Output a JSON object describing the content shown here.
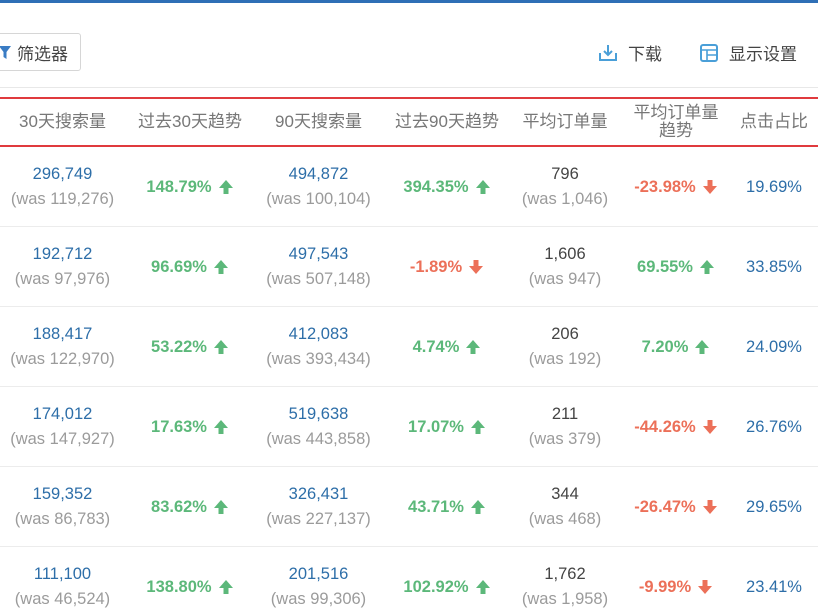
{
  "toolbar": {
    "filter_label": "筛选器",
    "download_label": "下载",
    "settings_label": "显示设置"
  },
  "columns": [
    {
      "label": "30天搜索量"
    },
    {
      "label": "过去30天趋势"
    },
    {
      "label": "90天搜索量"
    },
    {
      "label": "过去90天趋势"
    },
    {
      "label": "平均订单量"
    },
    {
      "label": "平均订单量趋势"
    },
    {
      "label": "点击占比"
    }
  ],
  "colors": {
    "up": "#5cb87a",
    "down": "#ec7059",
    "link_blue": "#2d6ea8",
    "highlight_border": "#e03a3e"
  },
  "rows": [
    {
      "search30": "296,749",
      "search30_was": "(was 119,276)",
      "trend30": "148.79%",
      "trend30_dir": "up",
      "search90": "494,872",
      "search90_was": "(was 100,104)",
      "trend90": "394.35%",
      "trend90_dir": "up",
      "orders": "796",
      "orders_was": "(was 1,046)",
      "orders_trend": "-23.98%",
      "orders_trend_dir": "down",
      "click_share": "19.69%"
    },
    {
      "search30": "192,712",
      "search30_was": "(was 97,976)",
      "trend30": "96.69%",
      "trend30_dir": "up",
      "search90": "497,543",
      "search90_was": "(was 507,148)",
      "trend90": "-1.89%",
      "trend90_dir": "down",
      "orders": "1,606",
      "orders_was": "(was 947)",
      "orders_trend": "69.55%",
      "orders_trend_dir": "up",
      "click_share": "33.85%"
    },
    {
      "search30": "188,417",
      "search30_was": "(was 122,970)",
      "trend30": "53.22%",
      "trend30_dir": "up",
      "search90": "412,083",
      "search90_was": "(was 393,434)",
      "trend90": "4.74%",
      "trend90_dir": "up",
      "orders": "206",
      "orders_was": "(was 192)",
      "orders_trend": "7.20%",
      "orders_trend_dir": "up",
      "click_share": "24.09%"
    },
    {
      "search30": "174,012",
      "search30_was": "(was 147,927)",
      "trend30": "17.63%",
      "trend30_dir": "up",
      "search90": "519,638",
      "search90_was": "(was 443,858)",
      "trend90": "17.07%",
      "trend90_dir": "up",
      "orders": "211",
      "orders_was": "(was 379)",
      "orders_trend": "-44.26%",
      "orders_trend_dir": "down",
      "click_share": "26.76%"
    },
    {
      "search30": "159,352",
      "search30_was": "(was 86,783)",
      "trend30": "83.62%",
      "trend30_dir": "up",
      "search90": "326,431",
      "search90_was": "(was 227,137)",
      "trend90": "43.71%",
      "trend90_dir": "up",
      "orders": "344",
      "orders_was": "(was 468)",
      "orders_trend": "-26.47%",
      "orders_trend_dir": "down",
      "click_share": "29.65%"
    },
    {
      "search30": "111,100",
      "search30_was": "(was 46,524)",
      "trend30": "138.80%",
      "trend30_dir": "up",
      "search90": "201,516",
      "search90_was": "(was 99,306)",
      "trend90": "102.92%",
      "trend90_dir": "up",
      "orders": "1,762",
      "orders_was": "(was 1,958)",
      "orders_trend": "-9.99%",
      "orders_trend_dir": "down",
      "click_share": "23.41%"
    }
  ]
}
